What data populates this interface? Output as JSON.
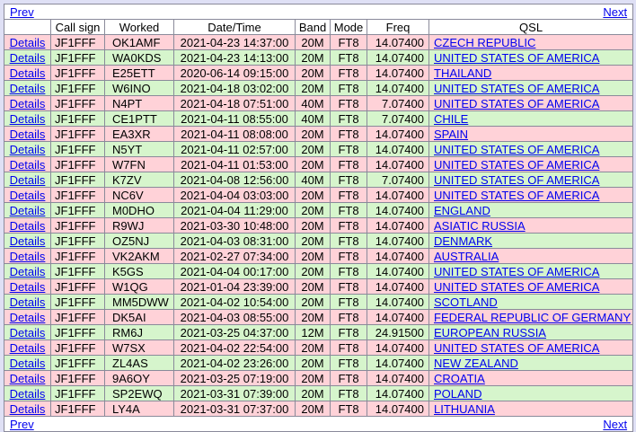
{
  "nav": {
    "prev_label": "Prev",
    "next_label": "Next"
  },
  "columns": [
    "",
    "Call sign",
    "Worked",
    "Date/Time",
    "Band",
    "Mode",
    "Freq",
    "QSL"
  ],
  "details_label": "Details",
  "row_colors": {
    "pink": "#ffd2d8",
    "green": "#d6f5cc"
  },
  "rows": [
    {
      "call": "JF1FFF",
      "worked": "OK1AMF",
      "datetime": "2021-04-23 14:37:00",
      "band": "20M",
      "mode": "FT8",
      "freq": "14.07400",
      "qsl": "CZECH REPUBLIC",
      "color": "pink"
    },
    {
      "call": "JF1FFF",
      "worked": "WA0KDS",
      "datetime": "2021-04-23 14:13:00",
      "band": "20M",
      "mode": "FT8",
      "freq": "14.07400",
      "qsl": "UNITED STATES OF AMERICA",
      "color": "green"
    },
    {
      "call": "JF1FFF",
      "worked": "E25ETT",
      "datetime": "2020-06-14 09:15:00",
      "band": "20M",
      "mode": "FT8",
      "freq": "14.07400",
      "qsl": "THAILAND",
      "color": "pink"
    },
    {
      "call": "JF1FFF",
      "worked": "W6INO",
      "datetime": "2021-04-18 03:02:00",
      "band": "20M",
      "mode": "FT8",
      "freq": "14.07400",
      "qsl": "UNITED STATES OF AMERICA",
      "color": "green"
    },
    {
      "call": "JF1FFF",
      "worked": "N4PT",
      "datetime": "2021-04-18 07:51:00",
      "band": "40M",
      "mode": "FT8",
      "freq": "7.07400",
      "qsl": "UNITED STATES OF AMERICA",
      "color": "pink"
    },
    {
      "call": "JF1FFF",
      "worked": "CE1PTT",
      "datetime": "2021-04-11 08:55:00",
      "band": "40M",
      "mode": "FT8",
      "freq": "7.07400",
      "qsl": "CHILE",
      "color": "green"
    },
    {
      "call": "JF1FFF",
      "worked": "EA3XR",
      "datetime": "2021-04-11 08:08:00",
      "band": "20M",
      "mode": "FT8",
      "freq": "14.07400",
      "qsl": "SPAIN",
      "color": "pink"
    },
    {
      "call": "JF1FFF",
      "worked": "N5YT",
      "datetime": "2021-04-11 02:57:00",
      "band": "20M",
      "mode": "FT8",
      "freq": "14.07400",
      "qsl": "UNITED STATES OF AMERICA",
      "color": "green"
    },
    {
      "call": "JF1FFF",
      "worked": "W7FN",
      "datetime": "2021-04-11 01:53:00",
      "band": "20M",
      "mode": "FT8",
      "freq": "14.07400",
      "qsl": "UNITED STATES OF AMERICA",
      "color": "pink"
    },
    {
      "call": "JF1FFF",
      "worked": "K7ZV",
      "datetime": "2021-04-08 12:56:00",
      "band": "40M",
      "mode": "FT8",
      "freq": "7.07400",
      "qsl": "UNITED STATES OF AMERICA",
      "color": "green"
    },
    {
      "call": "JF1FFF",
      "worked": "NC6V",
      "datetime": "2021-04-04 03:03:00",
      "band": "20M",
      "mode": "FT8",
      "freq": "14.07400",
      "qsl": "UNITED STATES OF AMERICA",
      "color": "pink"
    },
    {
      "call": "JF1FFF",
      "worked": "M0DHO",
      "datetime": "2021-04-04 11:29:00",
      "band": "20M",
      "mode": "FT8",
      "freq": "14.07400",
      "qsl": "ENGLAND",
      "color": "green"
    },
    {
      "call": "JF1FFF",
      "worked": "R9WJ",
      "datetime": "2021-03-30 10:48:00",
      "band": "20M",
      "mode": "FT8",
      "freq": "14.07400",
      "qsl": "ASIATIC RUSSIA",
      "color": "pink"
    },
    {
      "call": "JF1FFF",
      "worked": "OZ5NJ",
      "datetime": "2021-04-03 08:31:00",
      "band": "20M",
      "mode": "FT8",
      "freq": "14.07400",
      "qsl": "DENMARK",
      "color": "green"
    },
    {
      "call": "JF1FFF",
      "worked": "VK2AKM",
      "datetime": "2021-02-27 07:34:00",
      "band": "20M",
      "mode": "FT8",
      "freq": "14.07400",
      "qsl": "AUSTRALIA",
      "color": "pink"
    },
    {
      "call": "JF1FFF",
      "worked": "K5GS",
      "datetime": "2021-04-04 00:17:00",
      "band": "20M",
      "mode": "FT8",
      "freq": "14.07400",
      "qsl": "UNITED STATES OF AMERICA",
      "color": "green"
    },
    {
      "call": "JF1FFF",
      "worked": "W1QG",
      "datetime": "2021-01-04 23:39:00",
      "band": "20M",
      "mode": "FT8",
      "freq": "14.07400",
      "qsl": "UNITED STATES OF AMERICA",
      "color": "pink"
    },
    {
      "call": "JF1FFF",
      "worked": "MM5DWW",
      "datetime": "2021-04-02 10:54:00",
      "band": "20M",
      "mode": "FT8",
      "freq": "14.07400",
      "qsl": "SCOTLAND",
      "color": "green"
    },
    {
      "call": "JF1FFF",
      "worked": "DK5AI",
      "datetime": "2021-04-03 08:55:00",
      "band": "20M",
      "mode": "FT8",
      "freq": "14.07400",
      "qsl": "FEDERAL REPUBLIC OF GERMANY",
      "color": "pink"
    },
    {
      "call": "JF1FFF",
      "worked": "RM6J",
      "datetime": "2021-03-25 04:37:00",
      "band": "12M",
      "mode": "FT8",
      "freq": "24.91500",
      "qsl": "EUROPEAN RUSSIA",
      "color": "green"
    },
    {
      "call": "JF1FFF",
      "worked": "W7SX",
      "datetime": "2021-04-02 22:54:00",
      "band": "20M",
      "mode": "FT8",
      "freq": "14.07400",
      "qsl": "UNITED STATES OF AMERICA",
      "color": "pink"
    },
    {
      "call": "JF1FFF",
      "worked": "ZL4AS",
      "datetime": "2021-04-02 23:26:00",
      "band": "20M",
      "mode": "FT8",
      "freq": "14.07400",
      "qsl": "NEW ZEALAND",
      "color": "green"
    },
    {
      "call": "JF1FFF",
      "worked": "9A6OY",
      "datetime": "2021-03-25 07:19:00",
      "band": "20M",
      "mode": "FT8",
      "freq": "14.07400",
      "qsl": "CROATIA",
      "color": "pink"
    },
    {
      "call": "JF1FFF",
      "worked": "SP2EWQ",
      "datetime": "2021-03-31 07:39:00",
      "band": "20M",
      "mode": "FT8",
      "freq": "14.07400",
      "qsl": "POLAND",
      "color": "green"
    },
    {
      "call": "JF1FFF",
      "worked": "LY4A",
      "datetime": "2021-03-31 07:37:00",
      "band": "20M",
      "mode": "FT8",
      "freq": "14.07400",
      "qsl": "LITHUANIA",
      "color": "pink"
    }
  ]
}
